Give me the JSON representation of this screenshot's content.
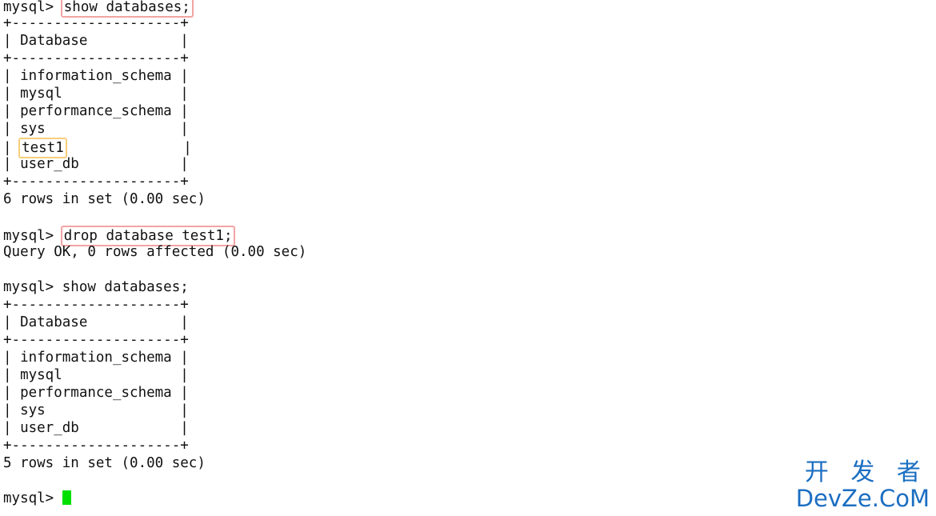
{
  "terminal": {
    "prompt": "mysql> ",
    "colors": {
      "text": "#111111",
      "background": "#ffffff",
      "highlight_red_border": "#f4a3a3",
      "highlight_yellow_border": "#f6cf7c",
      "cursor": "#00e000",
      "watermark": "#1b6ec2"
    },
    "lines": [
      {
        "id": "l01",
        "prompt": "mysql> ",
        "command": "show databases;",
        "highlight": "red"
      },
      {
        "id": "l02",
        "text": "+--------------------+"
      },
      {
        "id": "l03",
        "text": "| Database           |"
      },
      {
        "id": "l04",
        "text": "+--------------------+"
      },
      {
        "id": "l05",
        "text": "| information_schema |"
      },
      {
        "id": "l06",
        "text": "| mysql              |"
      },
      {
        "id": "l07",
        "text": "| performance_schema |"
      },
      {
        "id": "l08",
        "text": "| sys                |"
      },
      {
        "id": "l09",
        "pre": "| ",
        "command": "test1",
        "post": "              |",
        "highlight": "yellow"
      },
      {
        "id": "l10",
        "text": "| user_db            |"
      },
      {
        "id": "l11",
        "text": "+--------------------+"
      },
      {
        "id": "l12",
        "text": "6 rows in set (0.00 sec)"
      },
      {
        "id": "l13",
        "text": ""
      },
      {
        "id": "l14",
        "prompt": "mysql> ",
        "command": "drop database test1;",
        "highlight": "red"
      },
      {
        "id": "l15",
        "text": "Query OK, 0 rows affected (0.00 sec)"
      },
      {
        "id": "l16",
        "text": ""
      },
      {
        "id": "l17",
        "text": "mysql> show databases;"
      },
      {
        "id": "l18",
        "text": "+--------------------+"
      },
      {
        "id": "l19",
        "text": "| Database           |"
      },
      {
        "id": "l20",
        "text": "+--------------------+"
      },
      {
        "id": "l21",
        "text": "| information_schema |"
      },
      {
        "id": "l22",
        "text": "| mysql              |"
      },
      {
        "id": "l23",
        "text": "| performance_schema |"
      },
      {
        "id": "l24",
        "text": "| sys                |"
      },
      {
        "id": "l25",
        "text": "| user_db            |"
      },
      {
        "id": "l26",
        "text": "+--------------------+"
      },
      {
        "id": "l27",
        "text": "5 rows in set (0.00 sec)"
      },
      {
        "id": "l28",
        "text": ""
      },
      {
        "id": "l29",
        "prompt": "mysql> ",
        "cursor": true
      }
    ]
  },
  "watermark": {
    "cn": "开 发 者",
    "en": "DevZe.CoM"
  }
}
